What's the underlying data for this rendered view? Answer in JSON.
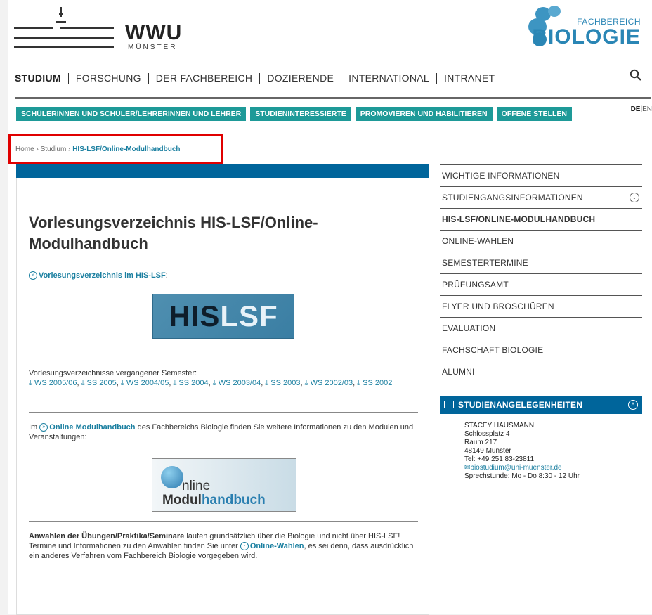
{
  "header": {
    "wwu_wordmark": "WWU",
    "wwu_city": "MÜNSTER",
    "fb_label": "FACHBEREICH",
    "fb_name": "BIOLOGIE"
  },
  "mainnav": [
    "STUDIUM",
    "FORSCHUNG",
    "DER FACHBEREICH",
    "DOZIERENDE",
    "INTERNATIONAL",
    "INTRANET"
  ],
  "subnav": [
    "SCHÜLERINNEN UND SCHÜLER/LEHRERINNEN UND LEHRER",
    "STUDIENINTERESSIERTE",
    "PROMOVIEREN UND HABILITIEREN",
    "OFFENE STELLEN"
  ],
  "lang": {
    "de": "DE",
    "sep": "|",
    "en": "EN"
  },
  "breadcrumb": {
    "home": "Home",
    "sep": "›",
    "studium": "Studium",
    "current": "HIS-LSF/Online-Modulhandbuch"
  },
  "main": {
    "title": "Vorlesungsverzeichnis HIS-LSF/Online-Modulhandbuch",
    "lsf_link": "Vorlesungsverzeichnis im HIS-LSF",
    "lsf_colon": ":",
    "logo_his": "HIS",
    "logo_lsf": "LSF",
    "past_label": "Vorlesungsverzeichnisse vergangener Semester:",
    "past_links": [
      "WS 2005/06",
      "SS 2005",
      "WS 2004/05",
      "SS 2004",
      "WS 2003/04",
      "SS 2003",
      "WS 2002/03",
      "SS 2002"
    ],
    "modul_pre": "Im",
    "modul_link": "Online Modulhandbuch",
    "modul_post": "des Fachbereichs Biologie finden Sie weitere Informationen zu den Modulen und Veranstaltungen:",
    "omh_online": "nline",
    "omh_modul": "Modul",
    "omh_handbuch": "handbuch",
    "anwahl_bold": "Anwahlen der Übungen/Praktika/Seminare",
    "anwahl_text1": "laufen grundsätzlich über die Biologie und nicht über HIS-LSF!",
    "anwahl_text2_pre": "Termine und Informationen zu den Anwahlen finden Sie unter",
    "anwahl_link": "Online-Wahlen",
    "anwahl_text2_post": ", es sei denn, dass ausdrücklich ein anderes Verfahren vom Fachbereich Biologie vorgegeben wird."
  },
  "sidebar": {
    "items": [
      "WICHTIGE INFORMATIONEN",
      "STUDIENGANGSINFORMATIONEN",
      "HIS-LSF/ONLINE-MODULHANDBUCH",
      "ONLINE-WAHLEN",
      "SEMESTERTERMINE",
      "PRÜFUNGSAMT",
      "FLYER UND BROSCHÜREN",
      "EVALUATION",
      "FACHSCHAFT BIOLOGIE",
      "ALUMNI"
    ],
    "contact_title": "STUDIENANGELEGENHEITEN",
    "contact": {
      "name": "STACEY HAUSMANN",
      "street": "Schlossplatz 4",
      "room": "Raum 217",
      "city": "48149 Münster",
      "tel": "Tel: +49 251 83-23811",
      "email": "biostudium@uni-muenster.de",
      "hours": "Sprechstunde: Mo - Do 8:30 - 12 Uhr"
    }
  },
  "colors": {
    "accent_teal": "#1e9a98",
    "header_blue": "#00659b",
    "link": "#1a7fa0",
    "highlight": "#e00000"
  }
}
